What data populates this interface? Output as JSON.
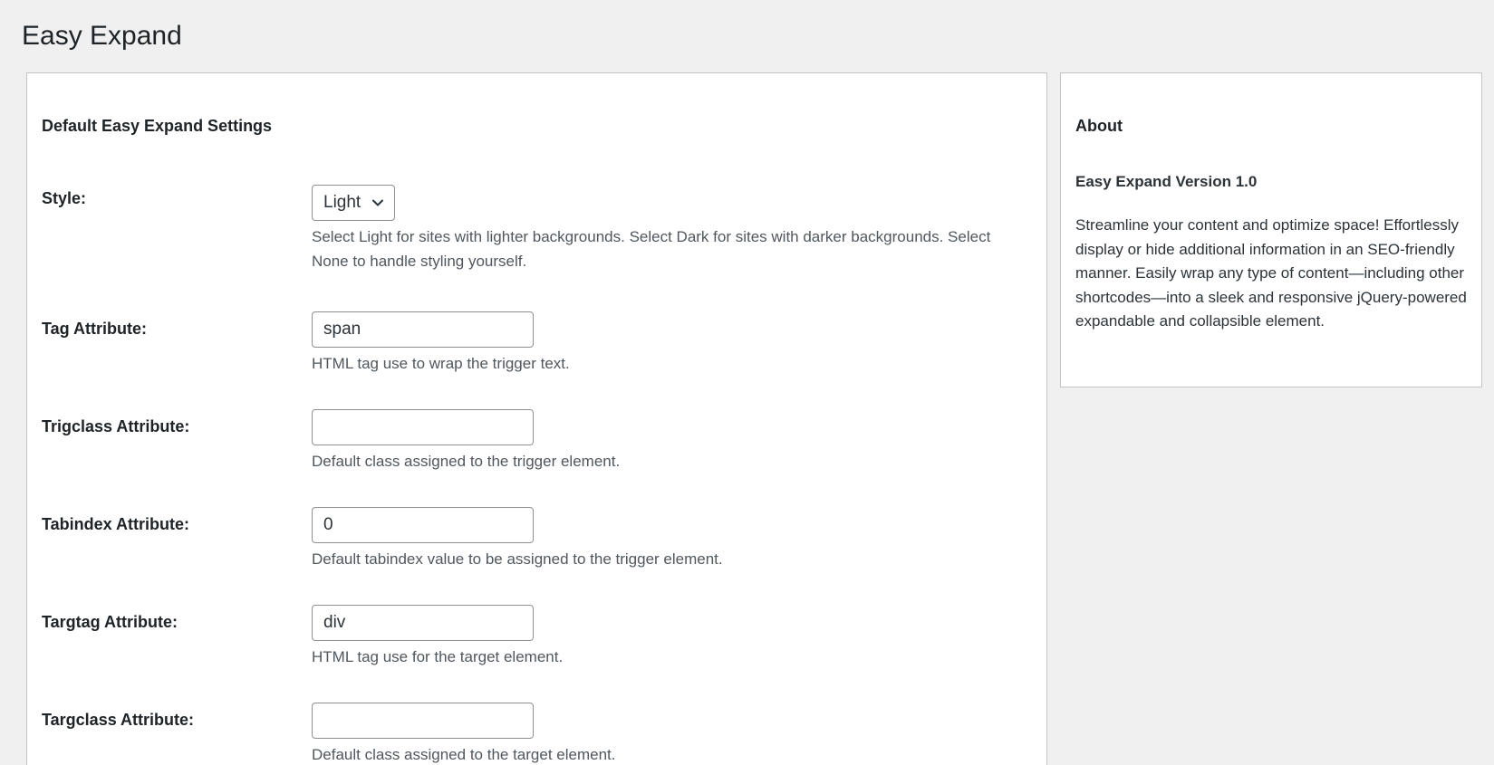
{
  "page": {
    "title": "Easy Expand"
  },
  "settings": {
    "section_title": "Default Easy Expand Settings",
    "fields": {
      "style": {
        "label": "Style:",
        "value": "Light",
        "description": "Select Light for sites with lighter backgrounds. Select Dark for sites with darker backgrounds. Select None to handle styling yourself."
      },
      "tag": {
        "label": "Tag Attribute:",
        "value": "span",
        "description": "HTML tag use to wrap the trigger text."
      },
      "trigclass": {
        "label": "Trigclass Attribute:",
        "value": "",
        "description": "Default class assigned to the trigger element."
      },
      "tabindex": {
        "label": "Tabindex Attribute:",
        "value": "0",
        "description": "Default tabindex value to be assigned to the trigger element."
      },
      "targtag": {
        "label": "Targtag Attribute:",
        "value": "div",
        "description": "HTML tag use for the target element."
      },
      "targclass": {
        "label": "Targclass Attribute:",
        "value": "",
        "description": "Default class assigned to the target element."
      }
    }
  },
  "about": {
    "title": "About",
    "version": "Easy Expand Version 1.0",
    "text": "Streamline your content and optimize space! Effortlessly display or hide additional information in an SEO-friendly manner. Easily wrap any type of content—including other shortcodes—into a sleek and responsive jQuery-powered expandable and collapsible element."
  },
  "icons": {
    "select_arrow": "chevron-down-icon"
  },
  "colors": {
    "background": "#f0f0f1",
    "panel": "#ffffff",
    "border": "#c3c4c7",
    "input_border": "#8c8f94",
    "text": "#1d2327",
    "muted_text": "#50575e"
  }
}
